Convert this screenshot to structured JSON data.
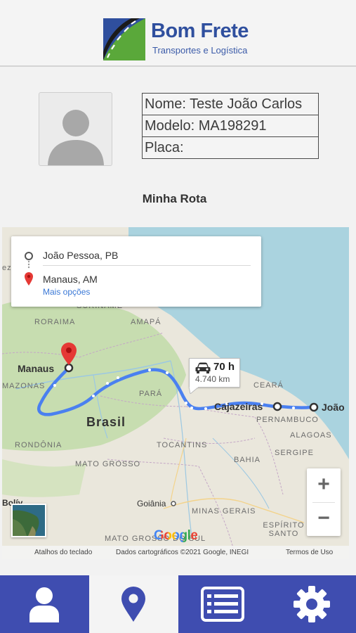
{
  "header": {
    "brand_title": "Bom Frete",
    "brand_subtitle": "Transportes e Logística",
    "brand_colors": {
      "blue": "#2f4f9e",
      "green": "#5aa83a"
    }
  },
  "profile": {
    "avatar": "user-avatar-placeholder",
    "nome": "Nome: Teste João Carlos",
    "modelo": "Modelo: MA198291",
    "placa": "Placa:"
  },
  "section_title": "Minha Rota",
  "map": {
    "origin": "João Pessoa, PB",
    "destination": "Manaus, AM",
    "more_options": "Mais opções",
    "duration": "70 h",
    "distance": "4.740 km",
    "cities": {
      "manaus": "Manaus",
      "cajazeiras": "Cajazeiras",
      "joao": "João",
      "goiania": "Goiânia",
      "brasil": "Brasil",
      "bolivia": "Bolív"
    },
    "regions": {
      "ez": "ez",
      "suriname": "SURINAME",
      "roraima": "RORAIMA",
      "amapa": "AMAPÁ",
      "amazonas": "MAZONAS",
      "para": "PARÁ",
      "ceara": "CEARÁ",
      "pernambuco": "PERNAMBUCO",
      "alagoas": "ALAGOAS",
      "sergipe": "SERGIPE",
      "tocantins": "TOCANTINS",
      "bahia": "BAHIA",
      "rondonia": "RONDÔNIA",
      "mato_grosso": "MATO GROSSO",
      "minas_gerais": "MINAS GERAIS",
      "espirito_santo": "ESPÍRITO SANTO",
      "mato_grosso_do_sul": "MATO GROSSO DO SUL"
    },
    "zoom_in": "+",
    "zoom_out": "−",
    "google": "Google",
    "attribution": {
      "shortcuts": "Atalhos do teclado",
      "data": "Dados cartográficos ©2021 Google, INEGI",
      "terms": "Termos de Uso"
    },
    "colors": {
      "route": "#4a80f0",
      "land": "#eae7dc",
      "forest": "#c7ddb0",
      "sea": "#aad3df",
      "pin": "#e53935"
    }
  },
  "nav": {
    "items": [
      {
        "icon": "user-icon",
        "active": false
      },
      {
        "icon": "location-pin-icon",
        "active": true
      },
      {
        "icon": "list-icon",
        "active": false
      },
      {
        "icon": "gear-icon",
        "active": false
      }
    ],
    "colors": {
      "bar": "#3f4db0",
      "active_bg": "#f4f4f4",
      "icon": "#ffffff",
      "active_icon": "#3f4db0"
    }
  }
}
